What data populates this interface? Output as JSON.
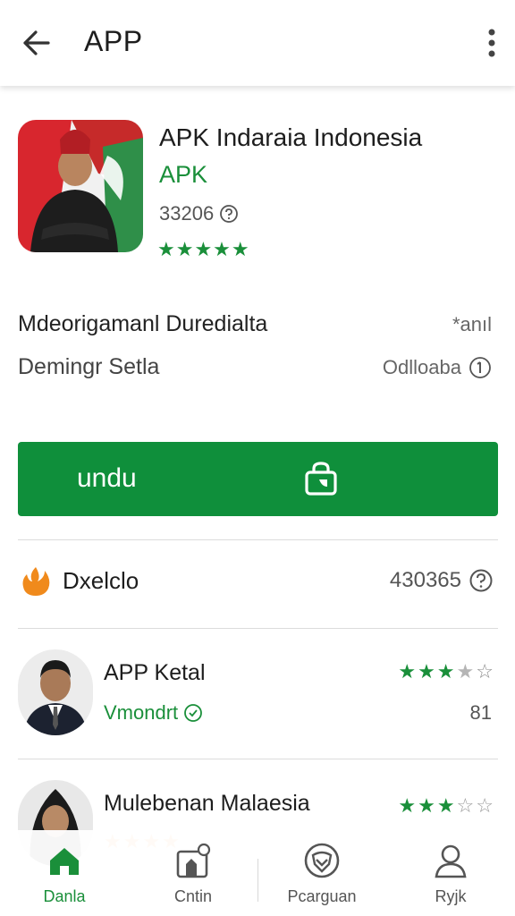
{
  "appbar": {
    "title": "APP",
    "back_icon": "arrow-left-icon",
    "more_icon": "more-vertical-icon"
  },
  "hero": {
    "title": "APK Indaraia Indonesia",
    "developer": "APK",
    "count": "33206",
    "count_icon": "help-circle-icon",
    "stars": "★★★★★",
    "rating": 5,
    "star_color": "#1a8f3a"
  },
  "info": [
    {
      "left": "Mdeorigamanl Duredialta",
      "right": "*anıl"
    },
    {
      "left": "Demingr Setla",
      "right": "Odlloaba",
      "right_icon": "info-circle-icon"
    }
  ],
  "install": {
    "label": "undu",
    "icon": "shopping-bag-icon",
    "color": "#0f8f3b"
  },
  "developer_row": {
    "icon": "fire-icon",
    "name": "Dxelclo",
    "count": "430365",
    "count_icon": "help-circle-icon"
  },
  "list": [
    {
      "name": "APP Ketal",
      "sub": "Vmondrt",
      "sub_icon": "check-circle-icon",
      "stars_filled": "★★★",
      "stars_half": "★",
      "stars_empty": "☆",
      "rating": 3.5,
      "number": "81"
    },
    {
      "name": "Mulebenan Malaesia",
      "stars_filled": "★★★",
      "stars_empty": "☆☆",
      "rating": 3,
      "orange_stars": "★★★★",
      "orange_rating": 4
    }
  ],
  "bottom_nav": [
    {
      "label": "Danla",
      "icon": "home-icon",
      "active": true
    },
    {
      "label": "Cntin",
      "icon": "apps-icon",
      "active": false
    },
    {
      "label": "Pcarguan",
      "icon": "shield-icon",
      "active": false
    },
    {
      "label": "Ryjk",
      "icon": "person-icon",
      "active": false
    }
  ],
  "colors": {
    "green": "#1a8f3a",
    "button": "#0f8f3b",
    "orange": "#f08a1c",
    "gray_star": "#b5b5b5"
  }
}
